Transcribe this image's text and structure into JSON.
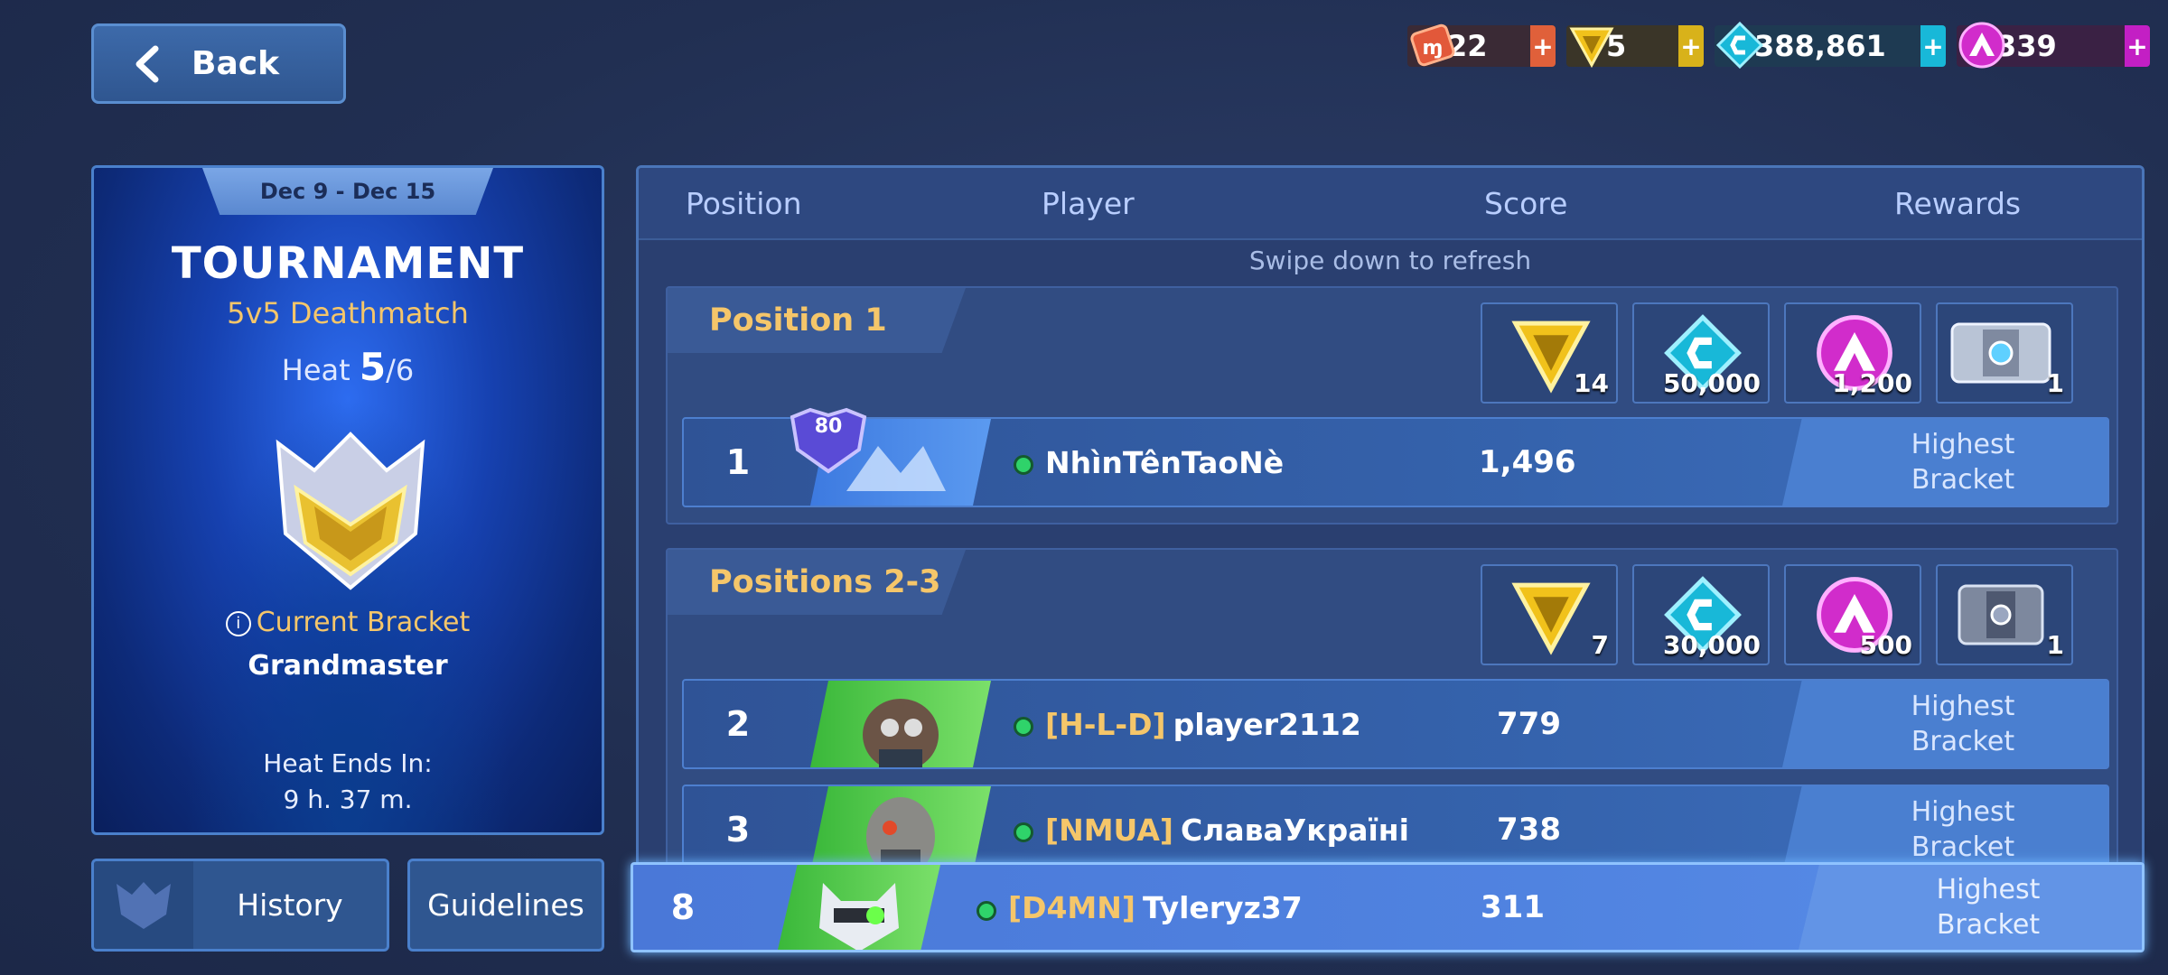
{
  "nav": {
    "back_label": "Back"
  },
  "currencies": [
    {
      "icon": "ticket-icon",
      "value": "22",
      "color": "#e0603a"
    },
    {
      "icon": "rank-token-icon",
      "value": "5",
      "color": "#d8b21a"
    },
    {
      "icon": "credits-icon",
      "value": "388,861",
      "color": "#18b8d8"
    },
    {
      "icon": "au-coin-icon",
      "value": "339",
      "color": "#c31fc4"
    }
  ],
  "currency_plus": "+",
  "tournament": {
    "dates": "Dec 9 - Dec 15",
    "title": "TOURNAMENT",
    "mode": "5v5 Deathmatch",
    "heat_label": "Heat",
    "heat_current": "5",
    "heat_total": "/6",
    "bracket_label": "Current Bracket",
    "bracket_name": "Grandmaster",
    "ends_label": "Heat Ends In:",
    "ends_value": "9 h. 37 m."
  },
  "buttons": {
    "history": "History",
    "guidelines": "Guidelines"
  },
  "leaderboard": {
    "columns": {
      "position": "Position",
      "player": "Player",
      "score": "Score",
      "rewards": "Rewards"
    },
    "refresh_hint": "Swipe down to refresh",
    "groups": [
      {
        "title": "Position 1",
        "rewards": [
          {
            "icon": "rank-token-icon",
            "count": "14"
          },
          {
            "icon": "credits-icon",
            "count": "50,000"
          },
          {
            "icon": "au-coin-icon",
            "count": "1,200"
          },
          {
            "icon": "supply-crate-icon",
            "count": "1"
          }
        ]
      },
      {
        "title": "Positions 2-3",
        "rewards": [
          {
            "icon": "rank-token-icon",
            "count": "7"
          },
          {
            "icon": "credits-icon",
            "count": "30,000"
          },
          {
            "icon": "au-coin-icon",
            "count": "500"
          },
          {
            "icon": "supply-crate-icon",
            "count": "1"
          }
        ]
      }
    ],
    "rows": [
      {
        "position": "1",
        "level": "80",
        "clan": "",
        "name": "NhìnTênTaoNè",
        "score": "1,496",
        "reward_line1": "Highest",
        "reward_line2": "Bracket"
      },
      {
        "position": "2",
        "clan": "[H-L-D]",
        "name": "player2112",
        "score": "779",
        "reward_line1": "Highest",
        "reward_line2": "Bracket"
      },
      {
        "position": "3",
        "clan": "[NMUA]",
        "name": "СлаваУкраїні",
        "score": "738",
        "reward_line1": "Highest",
        "reward_line2": "Bracket"
      }
    ],
    "me": {
      "position": "8",
      "clan": "[D4MN]",
      "name": "Tyleryz37",
      "score": "311",
      "reward_line1": "Highest",
      "reward_line2": "Bracket"
    }
  }
}
